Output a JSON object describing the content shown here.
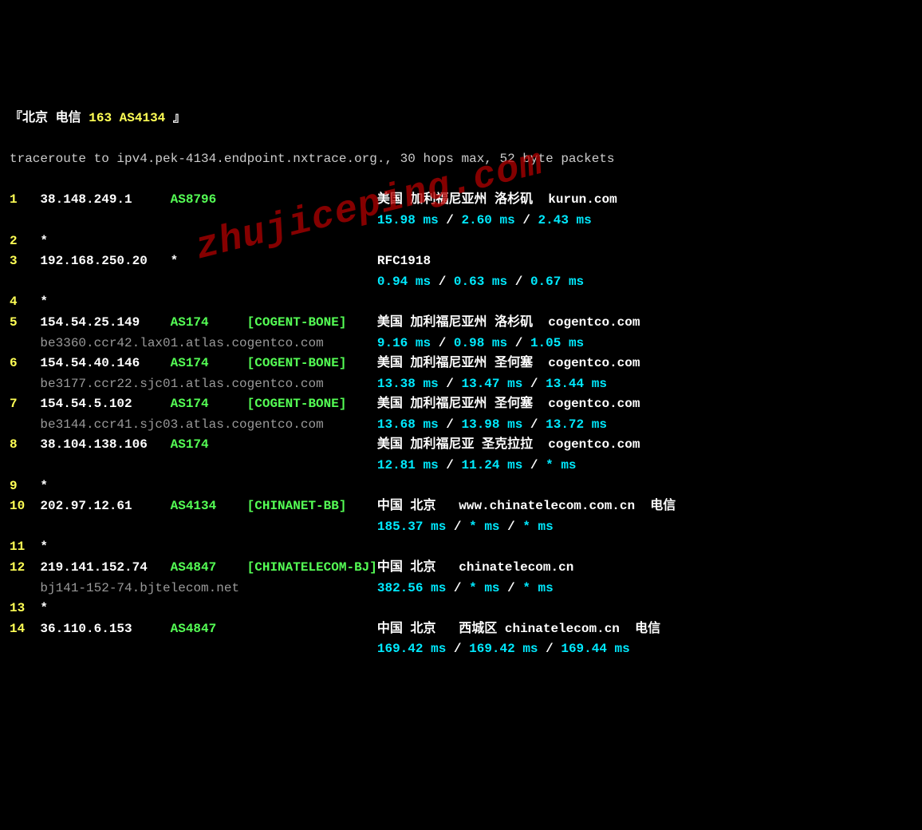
{
  "watermark": "zhujiceping.com",
  "header": {
    "open": "『",
    "loc": "北京",
    "isp": "电信",
    "backbone": "163 AS4134",
    "close": "』",
    "trace_line": "traceroute to ipv4.pek-4134.endpoint.nxtrace.org., 30 hops max, 52 byte packets"
  },
  "hops": [
    {
      "n": "1",
      "ip": "38.148.249.1",
      "asn": "AS8796",
      "tag": "",
      "geo": "美国 加利福尼亚州 洛杉矶  kurun.com",
      "lat": [
        "15.98 ms",
        "2.60 ms",
        "2.43 ms"
      ],
      "rdns": ""
    },
    {
      "n": "2",
      "ip": "*",
      "asn": "",
      "tag": "",
      "geo": "",
      "lat": [],
      "rdns": ""
    },
    {
      "n": "3",
      "ip": "192.168.250.20",
      "asn": "*",
      "tag": "",
      "geo": "RFC1918",
      "lat": [
        "0.94 ms",
        "0.63 ms",
        "0.67 ms"
      ],
      "rdns": ""
    },
    {
      "n": "4",
      "ip": "*",
      "asn": "",
      "tag": "",
      "geo": "",
      "lat": [],
      "rdns": ""
    },
    {
      "n": "5",
      "ip": "154.54.25.149",
      "asn": "AS174",
      "tag": "[COGENT-BONE]",
      "geo": "美国 加利福尼亚州 洛杉矶  cogentco.com",
      "lat": [
        "9.16 ms",
        "0.98 ms",
        "1.05 ms"
      ],
      "rdns": "be3360.ccr42.lax01.atlas.cogentco.com"
    },
    {
      "n": "6",
      "ip": "154.54.40.146",
      "asn": "AS174",
      "tag": "[COGENT-BONE]",
      "geo": "美国 加利福尼亚州 圣何塞  cogentco.com",
      "lat": [
        "13.38 ms",
        "13.47 ms",
        "13.44 ms"
      ],
      "rdns": "be3177.ccr22.sjc01.atlas.cogentco.com"
    },
    {
      "n": "7",
      "ip": "154.54.5.102",
      "asn": "AS174",
      "tag": "[COGENT-BONE]",
      "geo": "美国 加利福尼亚州 圣何塞  cogentco.com",
      "lat": [
        "13.68 ms",
        "13.98 ms",
        "13.72 ms"
      ],
      "rdns": "be3144.ccr41.sjc03.atlas.cogentco.com"
    },
    {
      "n": "8",
      "ip": "38.104.138.106",
      "asn": "AS174",
      "tag": "",
      "geo": "美国 加利福尼亚 圣克拉拉  cogentco.com",
      "lat": [
        "12.81 ms",
        "11.24 ms",
        "* ms"
      ],
      "rdns": ""
    },
    {
      "n": "9",
      "ip": "*",
      "asn": "",
      "tag": "",
      "geo": "",
      "lat": [],
      "rdns": ""
    },
    {
      "n": "10",
      "ip": "202.97.12.61",
      "asn": "AS4134",
      "tag": "[CHINANET-BB]",
      "geo": "中国 北京   www.chinatelecom.com.cn  电信",
      "lat": [
        "185.37 ms",
        "* ms",
        "* ms"
      ],
      "rdns": ""
    },
    {
      "n": "11",
      "ip": "*",
      "asn": "",
      "tag": "",
      "geo": "",
      "lat": [],
      "rdns": ""
    },
    {
      "n": "12",
      "ip": "219.141.152.74",
      "asn": "AS4847",
      "tag": "[CHINATELECOM-BJ]",
      "geo": "中国 北京   chinatelecom.cn",
      "lat": [
        "382.56 ms",
        "* ms",
        "* ms"
      ],
      "rdns": "bj141-152-74.bjtelecom.net"
    },
    {
      "n": "13",
      "ip": "*",
      "asn": "",
      "tag": "",
      "geo": "",
      "lat": [],
      "rdns": ""
    },
    {
      "n": "14",
      "ip": "36.110.6.153",
      "asn": "AS4847",
      "tag": "",
      "geo": "中国 北京   西城区 chinatelecom.cn  电信",
      "lat": [
        "169.42 ms",
        "169.42 ms",
        "169.44 ms"
      ],
      "rdns": ""
    }
  ]
}
